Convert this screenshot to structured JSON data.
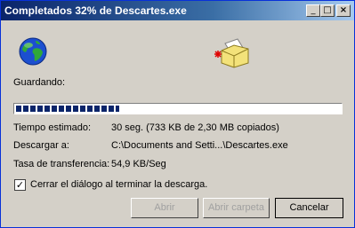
{
  "window": {
    "title": "Completados 32% de Descartes.exe",
    "minimize_glyph": "_",
    "maximize_glyph": "□",
    "close_glyph": "×"
  },
  "icons": {
    "left": "globe-icon",
    "right": "folder-icon"
  },
  "status": {
    "saving_label": "Guardando:"
  },
  "progress": {
    "fraction": 0.32
  },
  "details": {
    "time_label": "Tiempo estimado:",
    "time_value": "30 seg. (733 KB de 2,30 MB copiados)",
    "download_to_label": "Descargar a:",
    "download_to_value": "C:\\Documents and Setti...\\Descartes.exe",
    "rate_label": "Tasa de transferencia:",
    "rate_value": "54,9 KB/Seg"
  },
  "checkbox": {
    "checked": true,
    "label": "Cerrar el diálogo al terminar la descarga."
  },
  "buttons": {
    "open": "Abrir",
    "open_folder": "Abrir carpeta",
    "cancel": "Cancelar"
  },
  "colors": {
    "title_bar": "#0a246a",
    "progress": "#0a246a",
    "face": "#d4d0c8"
  }
}
